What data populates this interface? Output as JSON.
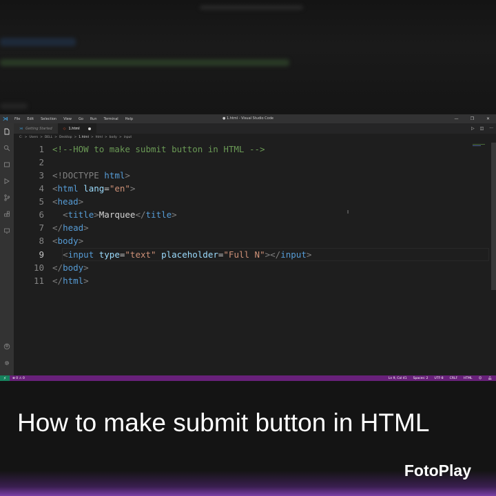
{
  "window": {
    "title": "● 1.html - Visual Studio Code",
    "menu": [
      "File",
      "Edit",
      "Selection",
      "View",
      "Go",
      "Run",
      "Terminal",
      "Help"
    ]
  },
  "tabs": [
    {
      "label": "Getting Started",
      "icon": "vscode-icon",
      "active": false
    },
    {
      "label": "1.html",
      "icon": "html-file-icon",
      "active": true,
      "modified": true
    }
  ],
  "breadcrumb": [
    "C:",
    ">",
    "Users",
    ">",
    "DELL",
    ">",
    "Desktop",
    ">",
    "1.html",
    ">",
    "html",
    ">",
    "body",
    ">",
    "input"
  ],
  "editor": {
    "current_line": 9,
    "lines": [
      {
        "n": "1"
      },
      {
        "n": "2"
      },
      {
        "n": "3"
      },
      {
        "n": "4"
      },
      {
        "n": "5"
      },
      {
        "n": "6"
      },
      {
        "n": "7"
      },
      {
        "n": "8"
      },
      {
        "n": "9"
      },
      {
        "n": "10"
      },
      {
        "n": "11"
      }
    ],
    "code": {
      "l1_comment": "<!--HOW to make submit button in HTML -->",
      "l3_doctype": "<!DOCTYPE ",
      "l3_html": "html",
      "l3_close": ">",
      "l4_open": "<",
      "l4_tag": "html",
      "l4_attr": " lang",
      "l4_eq": "=",
      "l4_val": "\"en\"",
      "l4_close": ">",
      "l5_open": "<",
      "l5_tag": "head",
      "l5_close": ">",
      "l6_open": "<",
      "l6_tag": "title",
      "l6_close": ">",
      "l6_text": "Marquee",
      "l6_end_open": "</",
      "l6_end_tag": "title",
      "l6_end_close": ">",
      "l7_open": "</",
      "l7_tag": "head",
      "l7_close": ">",
      "l8_open": "<",
      "l8_tag": "body",
      "l8_close": ">",
      "l9_open": "<",
      "l9_tag": "input",
      "l9_attr1": " type",
      "l9_eq1": "=",
      "l9_val1": "\"text\"",
      "l9_attr2": " placeholder",
      "l9_eq2": "=",
      "l9_val2": "\"Full N\"",
      "l9_close": ">",
      "l9_end_open": "</",
      "l9_end_tag": "input",
      "l9_end_close": ">",
      "l10_open": "</",
      "l10_tag": "body",
      "l10_close": ">",
      "l11_open": "</",
      "l11_tag": "html",
      "l11_close": ">"
    }
  },
  "statusbar": {
    "errors": "⊗ 0 ⚠ 0",
    "position": "Ln 9, Col 41",
    "spaces": "Spaces: 2",
    "encoding": "UTF-8",
    "eol": "CRLF",
    "language": "HTML"
  },
  "caption": "How to make submit button in HTML",
  "watermark": "FotoPlay",
  "colors": {
    "statusbar": "#68217a",
    "comment": "#6a9955",
    "tag": "#569cd6",
    "attribute": "#9cdcfe",
    "string": "#ce9178"
  }
}
